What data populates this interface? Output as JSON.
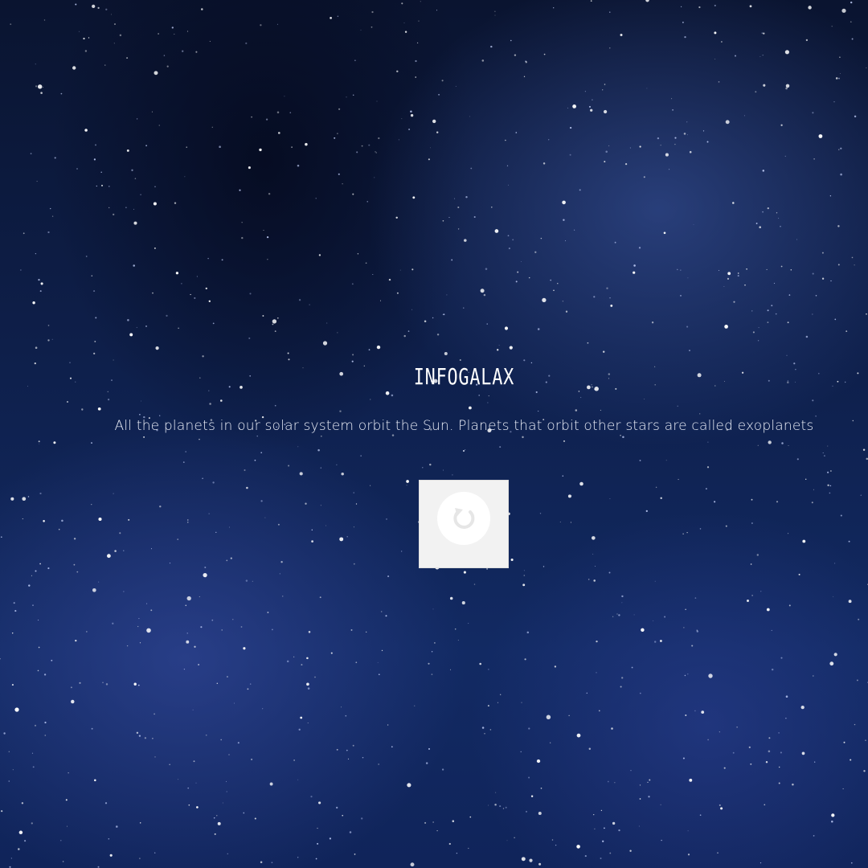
{
  "app": {
    "title": "INFOGALAX",
    "tagline": "All the planets in our solar system orbit the Sun. Planets that orbit other stars are called exoplanets"
  },
  "refresh_card": {
    "icon": "refresh-icon",
    "background_color": "#f2f2f2",
    "icon_color": "#e6e6e6"
  },
  "background": {
    "theme": "starry night sky",
    "colors": [
      "#0a1430",
      "#122a63",
      "#ffffff"
    ]
  }
}
